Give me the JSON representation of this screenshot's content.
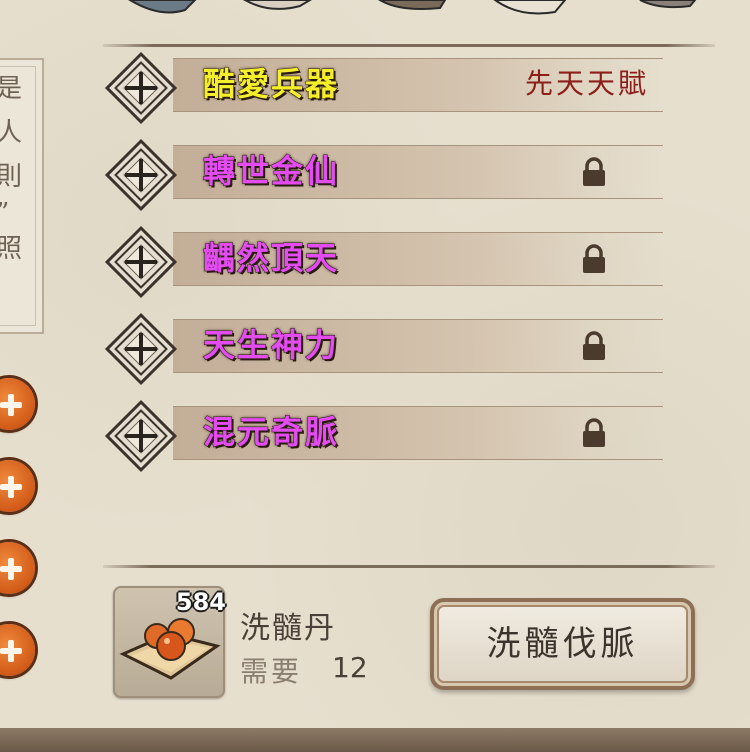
{
  "side_panel": {
    "chars": [
      "是",
      "人",
      "則",
      "”",
      "照"
    ]
  },
  "talents": [
    {
      "name": "酷愛兵器",
      "color": "yellow",
      "tag": "先天天賦",
      "locked": false
    },
    {
      "name": "轉世金仙",
      "color": "purple",
      "tag": "",
      "locked": true
    },
    {
      "name": "齵然頂天",
      "color": "purple",
      "tag": "",
      "locked": true
    },
    {
      "name": "天生神力",
      "color": "purple",
      "tag": "",
      "locked": true
    },
    {
      "name": "混元奇脈",
      "color": "purple",
      "tag": "",
      "locked": true
    }
  ],
  "item": {
    "count": "584",
    "name": "洗髓丹",
    "need_label": "需要",
    "need_value": "12"
  },
  "action_button": {
    "label": "洗髓伐脈"
  },
  "icons": {
    "talent_slot": "diamond-cross-icon",
    "lock": "lock-icon",
    "plus": "plus-icon",
    "item": "pill-dish-icon"
  },
  "colors": {
    "talent_yellow": "#f4ef2a",
    "talent_purple": "#e24cf0",
    "tag_red": "#8c1f1a",
    "plus_orange": "#e0702a"
  }
}
